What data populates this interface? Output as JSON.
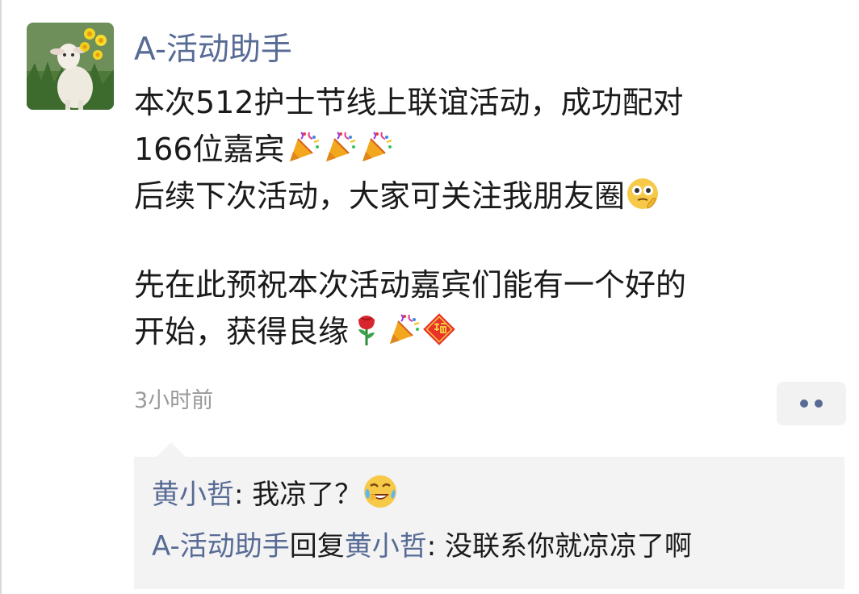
{
  "post": {
    "author": "A-活动助手",
    "lines": [
      "本次512护士节线上联谊活动，成功配对",
      "166位嘉宾",
      "后续下次活动，大家可关注我朋友圈",
      "先在此预祝本次活动嘉宾们能有一个好的",
      "开始，获得良缘"
    ],
    "emojis": {
      "line2": [
        "party-popper",
        "party-popper",
        "party-popper"
      ],
      "line3": [
        "thinking-face"
      ],
      "line5": [
        "rose",
        "party-popper",
        "fortune-fu"
      ]
    },
    "timestamp": "3小时前",
    "colors": {
      "name": "#576b95",
      "text": "#1a1a1a",
      "meta": "#9a9a9a",
      "comment_bg": "#f3f3f3"
    }
  },
  "comments": [
    {
      "author": "黄小哲",
      "separator": ": ",
      "text": "我凉了？",
      "emoji": "crying-laughing-face"
    },
    {
      "author": "A-活动助手",
      "reply_word": "回复",
      "reply_to": "黄小哲",
      "separator": ": ",
      "text": "没联系你就凉凉了啊"
    }
  ]
}
